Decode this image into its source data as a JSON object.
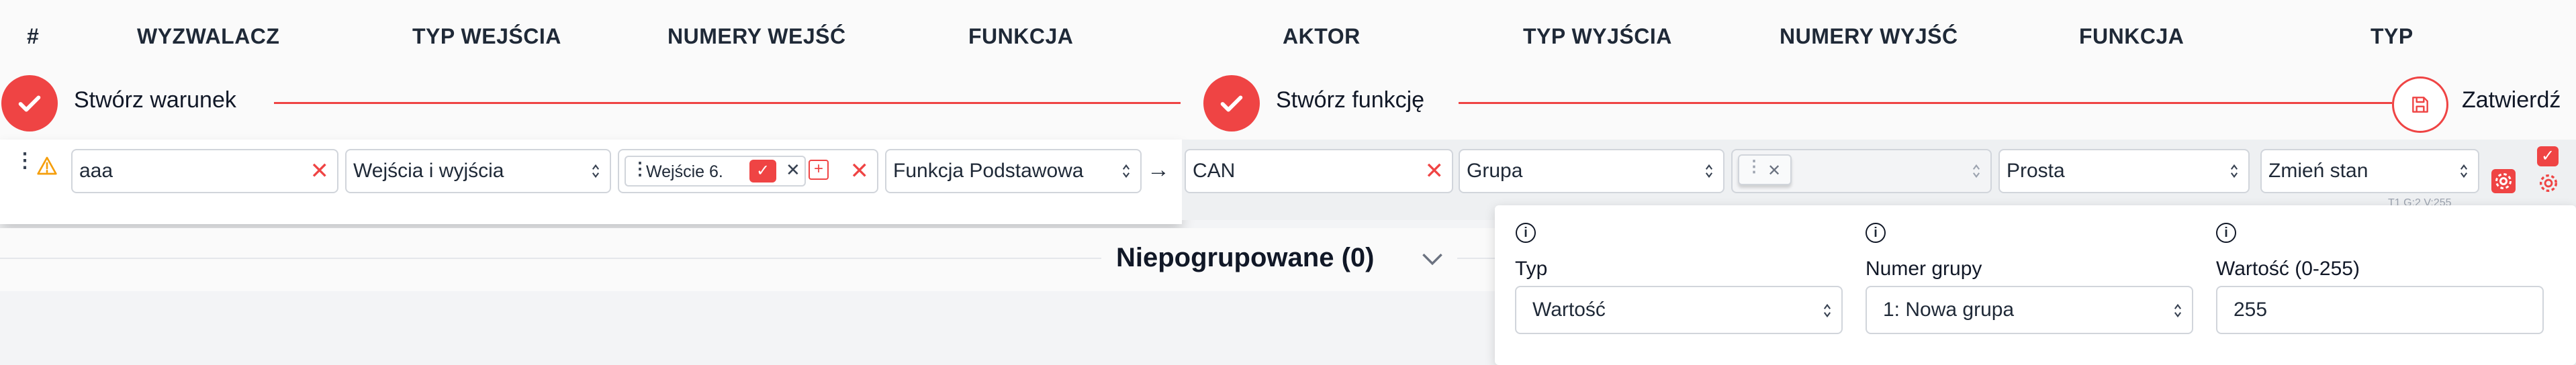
{
  "header": {
    "columns": [
      "#",
      "WYZWALACZ",
      "TYP WEJŚCIA",
      "NUMERY WEJŚĆ",
      "FUNKCJA",
      "AKTOR",
      "TYP WYJŚCIA",
      "NUMERY WYJŚĆ",
      "FUNKCJA",
      "TYP"
    ]
  },
  "steps": {
    "condition_label": "Stwórz warunek",
    "function_label": "Stwórz funkcję",
    "confirm_label": "Zatwierdź"
  },
  "row": {
    "trigger_value": "aaa",
    "input_type_value": "Wejścia i wyjścia",
    "input_chip_label": "Wejście 6.",
    "function_value": "Funkcja Podstawowa",
    "arrow": "→",
    "actor_value": "CAN",
    "output_type_value": "Grupa",
    "output_function_value": "Prosta",
    "type_value": "Zmień stan",
    "hint_text": "T1 G:2 V:255"
  },
  "group": {
    "title": "Niepogrupowane (0)"
  },
  "panel": {
    "fields": [
      {
        "label": "Typ",
        "value": "Wartość"
      },
      {
        "label": "Numer grupy",
        "value": "1: Nowa grupa"
      },
      {
        "label": "Wartość (0-255)",
        "value": "255"
      }
    ]
  },
  "colors": {
    "accent": "#ef4444",
    "warning": "#f59e0b",
    "border": "#d1d5db"
  }
}
